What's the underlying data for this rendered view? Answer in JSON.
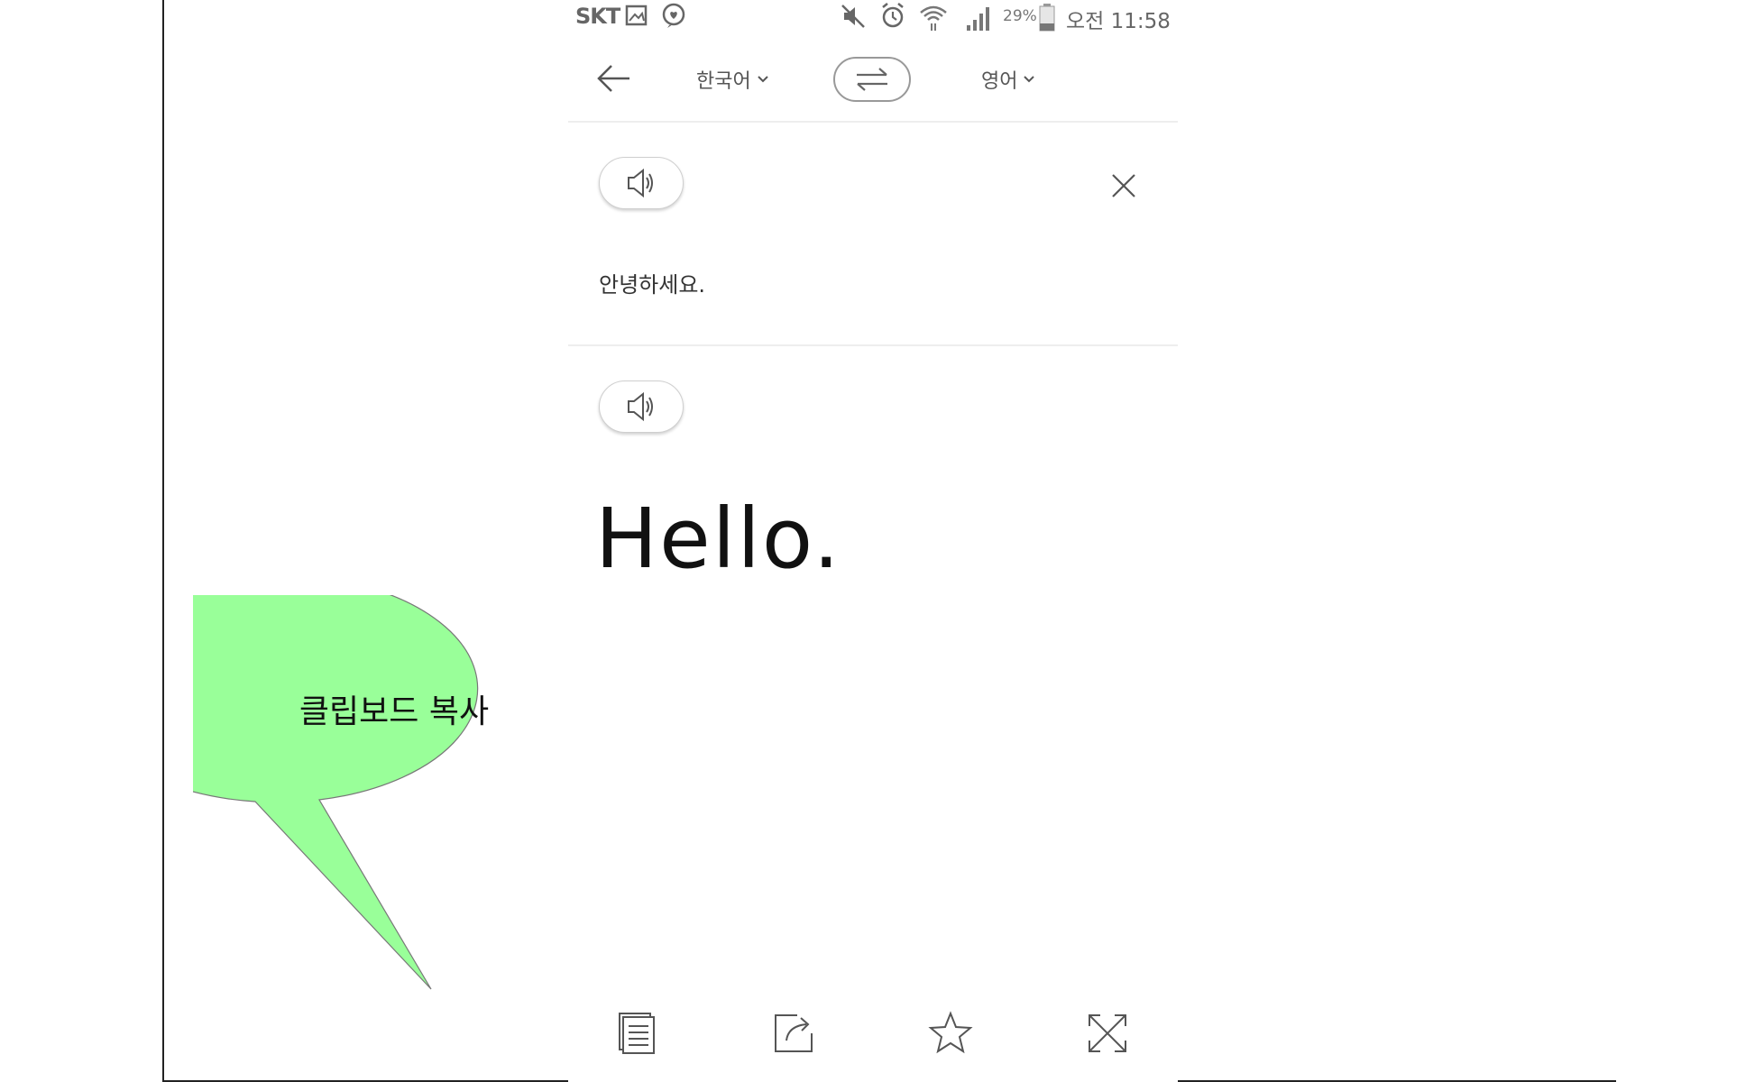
{
  "status_bar": {
    "carrier": "SKT",
    "battery_percent": "29%",
    "time": "오전 11:58",
    "icons": [
      "gallery-icon",
      "chat-icon",
      "mute-icon",
      "alarm-icon",
      "wifi-icon",
      "signal-icon",
      "battery-icon"
    ]
  },
  "toolbar": {
    "source_language": "한국어",
    "target_language": "영어"
  },
  "source": {
    "text": "안녕하세요."
  },
  "result": {
    "text": "Hello."
  },
  "bottom_bar": {
    "icons": [
      "copy-icon",
      "share-icon",
      "favorite-icon",
      "fullscreen-icon"
    ]
  },
  "callout": {
    "label": "클립보드 복사",
    "color": "#99ff99"
  }
}
